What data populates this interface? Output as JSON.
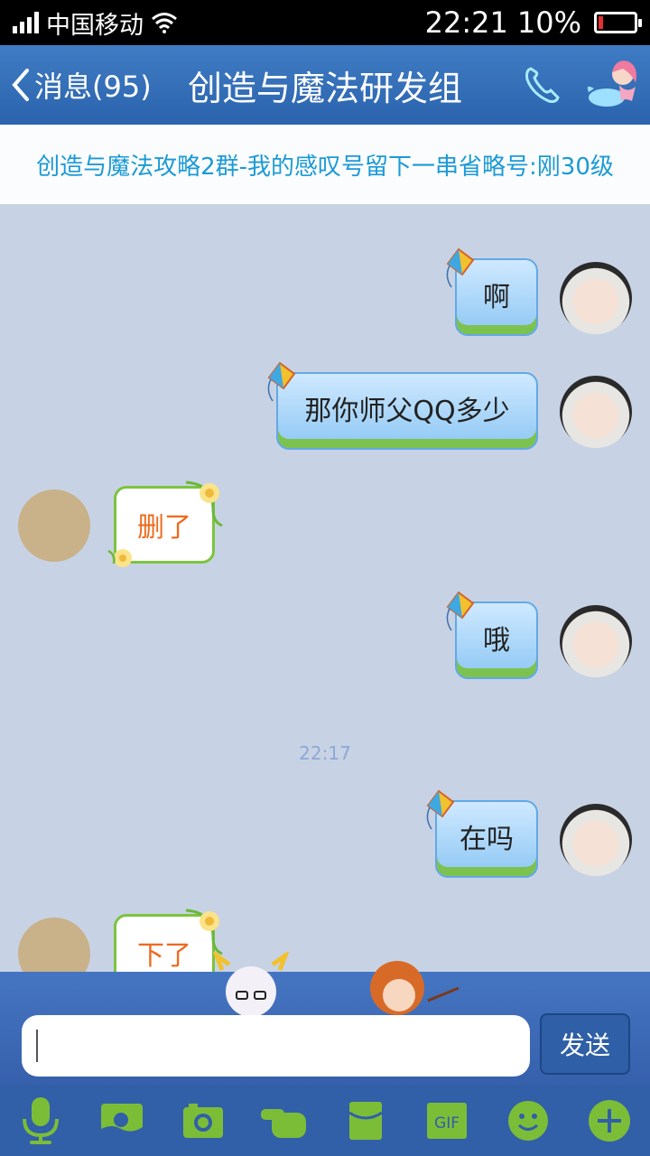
{
  "status_bar": {
    "carrier": "中国移动",
    "time": "22:21",
    "battery": "10%"
  },
  "header": {
    "back_label": "消息(95)",
    "title": "创造与魔法研发组"
  },
  "announcement": "创造与魔法攻略2群-我的感叹号留下一串省略号:刚30级",
  "messages": [
    {
      "sender": "self",
      "text": "啊"
    },
    {
      "sender": "self",
      "text": "那你师父QQ多少"
    },
    {
      "sender": "other",
      "text": "删了"
    },
    {
      "sender": "self",
      "text": "哦"
    },
    {
      "timestamp": "22:17"
    },
    {
      "sender": "self",
      "text": "在吗"
    },
    {
      "sender": "other",
      "text": "下了"
    }
  ],
  "input": {
    "placeholder": "",
    "send_label": "发送"
  },
  "toolbar": [
    {
      "icon": "microphone-icon"
    },
    {
      "icon": "picture-icon"
    },
    {
      "icon": "camera-icon"
    },
    {
      "icon": "poke-icon"
    },
    {
      "icon": "red-packet-icon"
    },
    {
      "icon": "gif-icon",
      "label": "GIF"
    },
    {
      "icon": "emoji-icon"
    },
    {
      "icon": "plus-icon"
    }
  ],
  "colors": {
    "accent": "#2b63ad",
    "toolbar_icon": "#7cbd38",
    "announce_text": "#1b9ad6"
  }
}
